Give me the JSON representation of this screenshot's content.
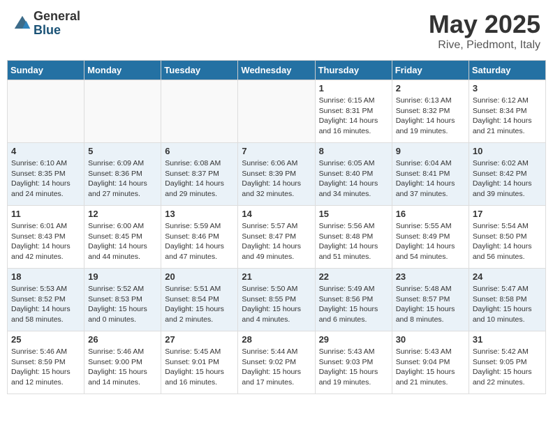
{
  "header": {
    "logo_general": "General",
    "logo_blue": "Blue",
    "month": "May 2025",
    "location": "Rive, Piedmont, Italy"
  },
  "days_of_week": [
    "Sunday",
    "Monday",
    "Tuesday",
    "Wednesday",
    "Thursday",
    "Friday",
    "Saturday"
  ],
  "weeks": [
    {
      "shade": "white",
      "days": [
        {
          "num": "",
          "empty": true
        },
        {
          "num": "",
          "empty": true
        },
        {
          "num": "",
          "empty": true
        },
        {
          "num": "",
          "empty": true
        },
        {
          "num": "1",
          "sunrise": "6:15 AM",
          "sunset": "8:31 PM",
          "daylight": "14 hours and 16 minutes."
        },
        {
          "num": "2",
          "sunrise": "6:13 AM",
          "sunset": "8:32 PM",
          "daylight": "14 hours and 19 minutes."
        },
        {
          "num": "3",
          "sunrise": "6:12 AM",
          "sunset": "8:34 PM",
          "daylight": "14 hours and 21 minutes."
        }
      ]
    },
    {
      "shade": "blue",
      "days": [
        {
          "num": "4",
          "sunrise": "6:10 AM",
          "sunset": "8:35 PM",
          "daylight": "14 hours and 24 minutes."
        },
        {
          "num": "5",
          "sunrise": "6:09 AM",
          "sunset": "8:36 PM",
          "daylight": "14 hours and 27 minutes."
        },
        {
          "num": "6",
          "sunrise": "6:08 AM",
          "sunset": "8:37 PM",
          "daylight": "14 hours and 29 minutes."
        },
        {
          "num": "7",
          "sunrise": "6:06 AM",
          "sunset": "8:39 PM",
          "daylight": "14 hours and 32 minutes."
        },
        {
          "num": "8",
          "sunrise": "6:05 AM",
          "sunset": "8:40 PM",
          "daylight": "14 hours and 34 minutes."
        },
        {
          "num": "9",
          "sunrise": "6:04 AM",
          "sunset": "8:41 PM",
          "daylight": "14 hours and 37 minutes."
        },
        {
          "num": "10",
          "sunrise": "6:02 AM",
          "sunset": "8:42 PM",
          "daylight": "14 hours and 39 minutes."
        }
      ]
    },
    {
      "shade": "white",
      "days": [
        {
          "num": "11",
          "sunrise": "6:01 AM",
          "sunset": "8:43 PM",
          "daylight": "14 hours and 42 minutes."
        },
        {
          "num": "12",
          "sunrise": "6:00 AM",
          "sunset": "8:45 PM",
          "daylight": "14 hours and 44 minutes."
        },
        {
          "num": "13",
          "sunrise": "5:59 AM",
          "sunset": "8:46 PM",
          "daylight": "14 hours and 47 minutes."
        },
        {
          "num": "14",
          "sunrise": "5:57 AM",
          "sunset": "8:47 PM",
          "daylight": "14 hours and 49 minutes."
        },
        {
          "num": "15",
          "sunrise": "5:56 AM",
          "sunset": "8:48 PM",
          "daylight": "14 hours and 51 minutes."
        },
        {
          "num": "16",
          "sunrise": "5:55 AM",
          "sunset": "8:49 PM",
          "daylight": "14 hours and 54 minutes."
        },
        {
          "num": "17",
          "sunrise": "5:54 AM",
          "sunset": "8:50 PM",
          "daylight": "14 hours and 56 minutes."
        }
      ]
    },
    {
      "shade": "blue",
      "days": [
        {
          "num": "18",
          "sunrise": "5:53 AM",
          "sunset": "8:52 PM",
          "daylight": "14 hours and 58 minutes."
        },
        {
          "num": "19",
          "sunrise": "5:52 AM",
          "sunset": "8:53 PM",
          "daylight": "15 hours and 0 minutes."
        },
        {
          "num": "20",
          "sunrise": "5:51 AM",
          "sunset": "8:54 PM",
          "daylight": "15 hours and 2 minutes."
        },
        {
          "num": "21",
          "sunrise": "5:50 AM",
          "sunset": "8:55 PM",
          "daylight": "15 hours and 4 minutes."
        },
        {
          "num": "22",
          "sunrise": "5:49 AM",
          "sunset": "8:56 PM",
          "daylight": "15 hours and 6 minutes."
        },
        {
          "num": "23",
          "sunrise": "5:48 AM",
          "sunset": "8:57 PM",
          "daylight": "15 hours and 8 minutes."
        },
        {
          "num": "24",
          "sunrise": "5:47 AM",
          "sunset": "8:58 PM",
          "daylight": "15 hours and 10 minutes."
        }
      ]
    },
    {
      "shade": "white",
      "days": [
        {
          "num": "25",
          "sunrise": "5:46 AM",
          "sunset": "8:59 PM",
          "daylight": "15 hours and 12 minutes."
        },
        {
          "num": "26",
          "sunrise": "5:46 AM",
          "sunset": "9:00 PM",
          "daylight": "15 hours and 14 minutes."
        },
        {
          "num": "27",
          "sunrise": "5:45 AM",
          "sunset": "9:01 PM",
          "daylight": "15 hours and 16 minutes."
        },
        {
          "num": "28",
          "sunrise": "5:44 AM",
          "sunset": "9:02 PM",
          "daylight": "15 hours and 17 minutes."
        },
        {
          "num": "29",
          "sunrise": "5:43 AM",
          "sunset": "9:03 PM",
          "daylight": "15 hours and 19 minutes."
        },
        {
          "num": "30",
          "sunrise": "5:43 AM",
          "sunset": "9:04 PM",
          "daylight": "15 hours and 21 minutes."
        },
        {
          "num": "31",
          "sunrise": "5:42 AM",
          "sunset": "9:05 PM",
          "daylight": "15 hours and 22 minutes."
        }
      ]
    }
  ]
}
